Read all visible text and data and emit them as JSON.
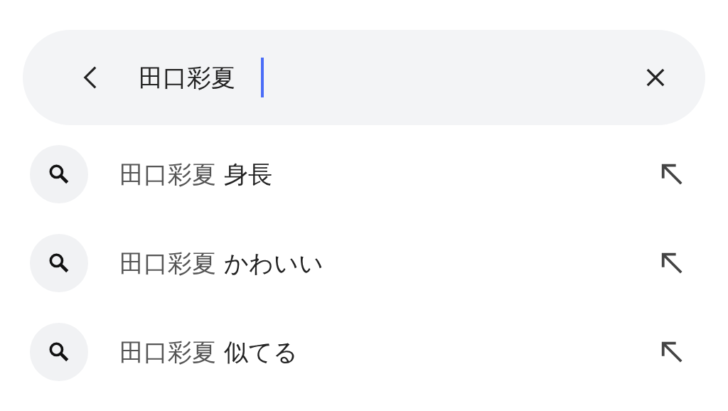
{
  "search": {
    "value": "田口彩夏"
  },
  "suggestions": [
    {
      "query": "田口彩夏",
      "completion": "身長"
    },
    {
      "query": "田口彩夏",
      "completion": "かわいい"
    },
    {
      "query": "田口彩夏",
      "completion": "似てる"
    }
  ]
}
